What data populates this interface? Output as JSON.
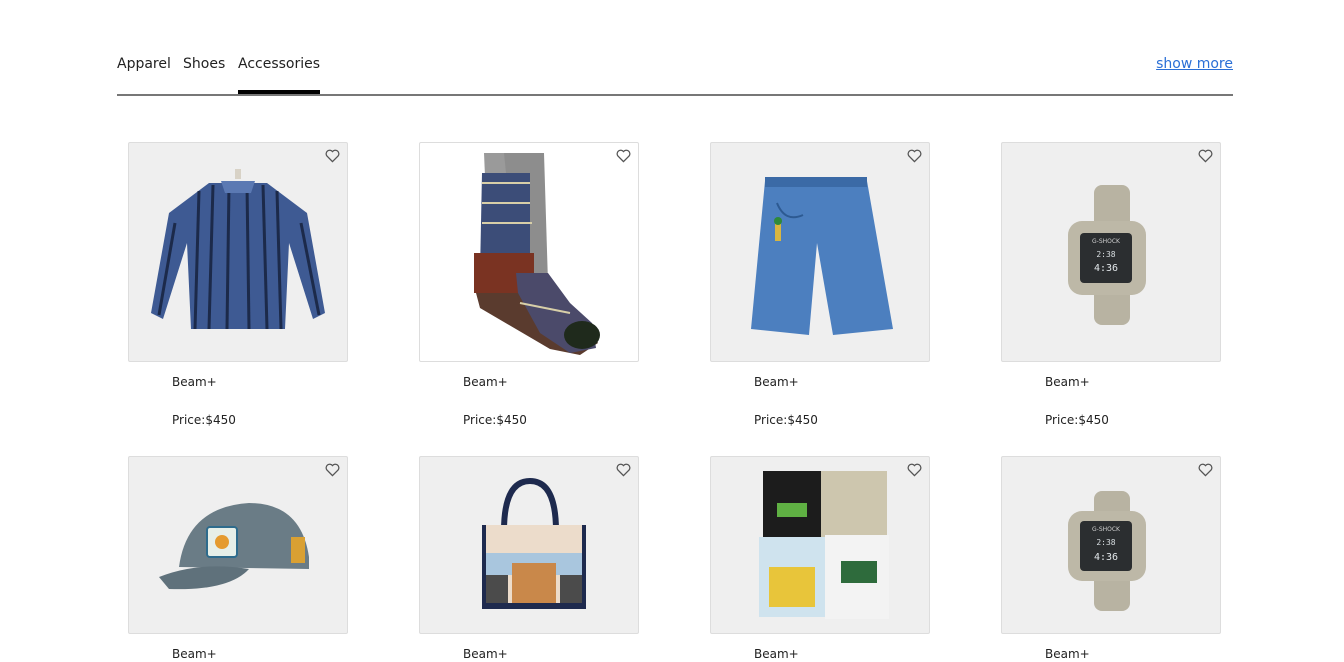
{
  "tabs": [
    {
      "label": "Apparel"
    },
    {
      "label": "Shoes"
    },
    {
      "label": "Accessories",
      "active": true
    }
  ],
  "show_more_label": "show more",
  "products": [
    {
      "brand": "Beam+",
      "price": "Price:$450",
      "image": "striped-blue-shirt"
    },
    {
      "brand": "Beam+",
      "price": "Price:$450",
      "image": "patterned-socks"
    },
    {
      "brand": "Beam+",
      "price": "Price:$450",
      "image": "denim-shorts"
    },
    {
      "brand": "Beam+",
      "price": "Price:$450",
      "image": "g-shock-watch"
    },
    {
      "brand": "Beam+",
      "price": "",
      "image": "grey-cap"
    },
    {
      "brand": "Beam+",
      "price": "",
      "image": "tote-bag"
    },
    {
      "brand": "Beam+",
      "price": "",
      "image": "tshirt-pack"
    },
    {
      "brand": "Beam+",
      "price": "",
      "image": "g-shock-watch"
    }
  ],
  "watch_display": {
    "brand_text": "G-SHOCK",
    "time_top": "2:38",
    "time_main": "4:36",
    "time_sub": "4:36"
  },
  "colors": {
    "accent_link": "#2a6fd6",
    "tab_underline": "#000000",
    "card_bg": "#efefef"
  }
}
